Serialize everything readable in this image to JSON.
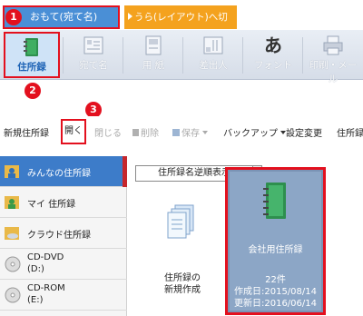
{
  "tabs": {
    "front_label": "おもて(宛て名)",
    "back_label": "うら(レイアウト)へ切替"
  },
  "badges": [
    "1",
    "2",
    "3"
  ],
  "ribbon": [
    {
      "label": "住所録",
      "icon": "address-book-icon",
      "active": true
    },
    {
      "label": "宛て名",
      "icon": "address-label-icon",
      "active": false
    },
    {
      "label": "用 紙",
      "icon": "paper-icon",
      "active": false
    },
    {
      "label": "差出人",
      "icon": "sender-icon",
      "active": false
    },
    {
      "label": "フォント",
      "icon": "font-icon",
      "active": false
    },
    {
      "label": "印刷・メール",
      "icon": "print-icon",
      "active": false
    }
  ],
  "font_icon_text": "あ",
  "toolbar": {
    "new_addressbook": "新規住所録",
    "open": "開く",
    "close": "閉じる",
    "delete": "削除",
    "save": "保存",
    "backup": "バックアップ",
    "settings": "設定変更",
    "addressbook": "住所録"
  },
  "sidebar": [
    {
      "label": "みんなの住所録"
    },
    {
      "label": "マイ 住所録"
    },
    {
      "label": "クラウド住所録"
    },
    {
      "label": "CD-DVD",
      "sub": "(D:)"
    },
    {
      "label": "CD-ROM",
      "sub": "(E:)"
    }
  ],
  "main": {
    "sort_label": "住所録名逆順表示",
    "new_card_line1": "住所録の",
    "new_card_line2": "新規作成",
    "company_card": {
      "name": "会社用住所録",
      "count": "22件",
      "created": "作成日:2015/08/14",
      "updated": "更新日:2016/06/14"
    }
  },
  "colors": {
    "accent": "#4a8fd6",
    "highlight": "#e3101e",
    "back_tab": "#f4a21e",
    "selected": "#3d7cc9"
  }
}
